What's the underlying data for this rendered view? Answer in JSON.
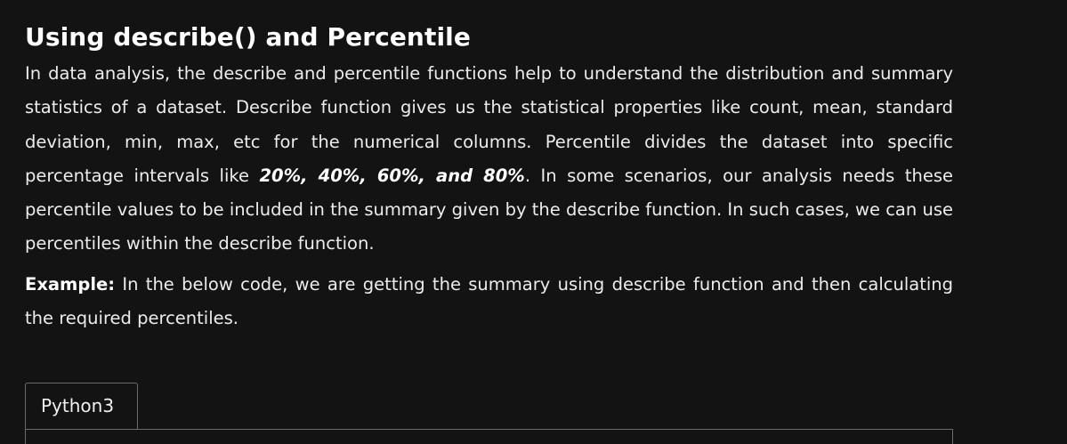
{
  "article": {
    "title": "Using describe() and Percentile",
    "paragraph1": {
      "before_emphasis": "In data analysis, the describe and percentile functions help to understand the distribution and summary statistics of a dataset. Describe function gives us the statistical properties like count, mean, standard deviation, min, max, etc for the numerical columns. Percentile divides the dataset into specific percentage intervals like ",
      "emphasis": "20%, 40%, 60%, and 80%",
      "after_emphasis": ". In some scenarios, our analysis needs these percentile values to be included in the summary given by the describe function. In such cases, we can use percentiles within the describe function."
    },
    "example": {
      "label": "Example:",
      "text": " In the below code, we are getting the summary using describe function and then calculating the required percentiles."
    }
  },
  "code_block": {
    "tabs": [
      "Python3"
    ]
  },
  "colors": {
    "background": "#131313",
    "text": "#ececec",
    "heading": "#ffffff",
    "border": "#6b6b6b"
  }
}
